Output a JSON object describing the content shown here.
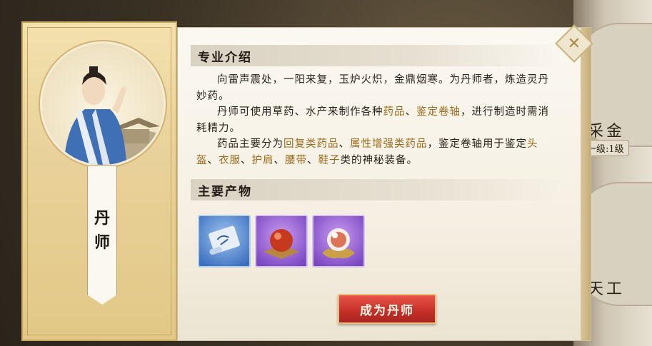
{
  "colors": {
    "highlight": "#9c6a1b",
    "button": "#c8312a",
    "panel": "#f5f0e3"
  },
  "side": {
    "top_label": "采金",
    "top_level": "一级:1级",
    "bottom_label": "天工"
  },
  "profession": {
    "name_char_1": "丹",
    "name_char_2": "师",
    "portrait_icon": "alchemist-portrait"
  },
  "intro": {
    "title": "专业介绍",
    "p1": "向雷声震处，一阳来复，玉炉火炽，金鼎烟寒。为丹师者，炼造灵丹妙药。",
    "p2_a": "丹师可使用草药、水产来制作各种",
    "p2_h1": "药品",
    "p2_b": "、",
    "p2_h2": "鉴定卷轴",
    "p2_c": "，进行制造时需消耗精力。",
    "p3_a": "药品主要分为",
    "p3_h1": "回复类药品",
    "p3_b": "、",
    "p3_h2": "属性增强类药品",
    "p3_c": "，鉴定卷轴用于鉴定",
    "p3_h3": "头盔",
    "p3_d": "、",
    "p3_h4": "衣服",
    "p3_e": "、",
    "p3_h5": "护肩",
    "p3_f": "、",
    "p3_h6": "腰带",
    "p3_g": "、",
    "p3_h7": "鞋子",
    "p3_h": "类的神秘装备。"
  },
  "products": {
    "title": "主要产物",
    "items": [
      {
        "icon": "scroll-icon",
        "rarity": "blue"
      },
      {
        "icon": "red-pill-icon",
        "rarity": "purple"
      },
      {
        "icon": "lotus-pearl-icon",
        "rarity": "purple"
      }
    ]
  },
  "action": {
    "label": "成为丹师"
  },
  "close_icon": "close-icon"
}
